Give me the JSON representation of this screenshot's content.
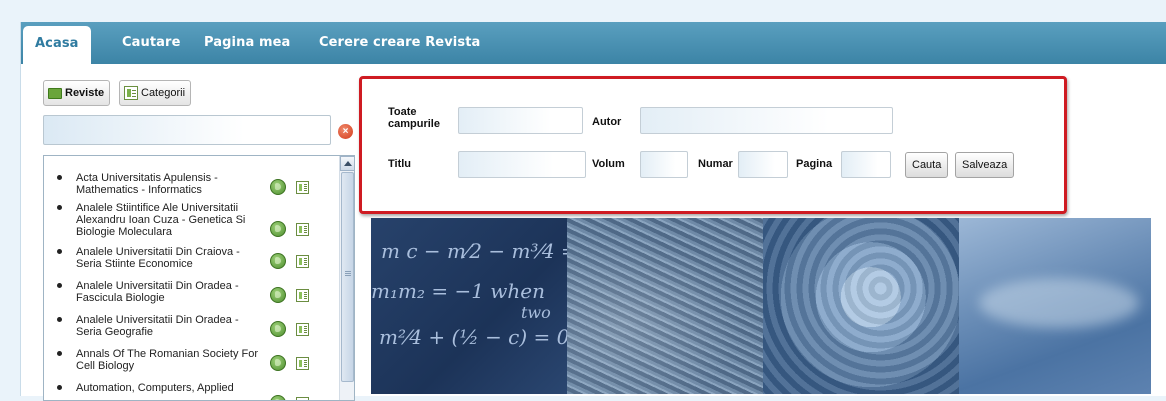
{
  "tabs": [
    {
      "label": "Acasa",
      "active": true
    },
    {
      "label": "Cautare",
      "active": false
    },
    {
      "label": "Pagina mea",
      "active": false
    },
    {
      "label": "Cerere creare Revista",
      "active": false
    }
  ],
  "sidebar": {
    "toggle_reviste": "Reviste",
    "toggle_categorii": "Categorii",
    "filter_value": "",
    "items": [
      {
        "label": "Acta Universitatis Apulensis - Mathematics - Informatics"
      },
      {
        "label": "Analele Stiintifice Ale Universitatii Alexandru Ioan Cuza - Genetica Si Biologie Moleculara"
      },
      {
        "label": "Analele Universitatii Din Craiova - Seria Stiinte Economice"
      },
      {
        "label": "Analele Universitatii Din Oradea - Fascicula Biologie"
      },
      {
        "label": "Analele Universitatii Din Oradea - Seria Geografie"
      },
      {
        "label": "Annals Of The Romanian Society For Cell Biology"
      },
      {
        "label": "Automation, Computers, Applied"
      }
    ]
  },
  "search": {
    "label_toate_line1": "Toate",
    "label_toate_line2": "campurile",
    "label_autor": "Autor",
    "label_titlu": "Titlu",
    "label_volum": "Volum",
    "label_numar": "Numar",
    "label_pagina": "Pagina",
    "button_cauta": "Cauta",
    "button_salveaza": "Salveaza",
    "highlight_color": "#cf1b22"
  },
  "colors": {
    "tabbar": "#4a90b0",
    "active_tab_text": "#2f7ba0",
    "page_bg": "#eaf3fa"
  },
  "icons": [
    "folder-icon",
    "category-icon",
    "clear-icon",
    "globe-icon",
    "page-icon",
    "scroll-up-icon"
  ]
}
